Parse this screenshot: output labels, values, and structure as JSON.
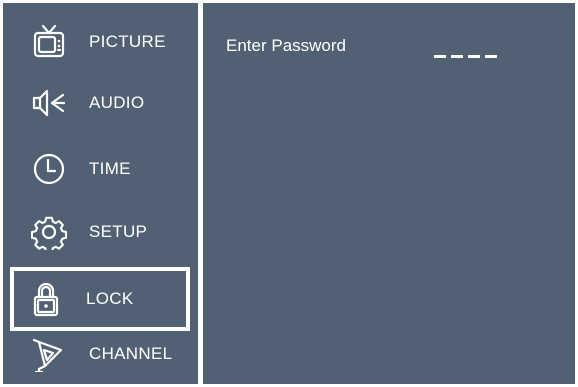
{
  "menu": {
    "items": [
      {
        "label": "PICTURE",
        "icon": "tv-icon",
        "selected": false
      },
      {
        "label": "AUDIO",
        "icon": "speaker-icon",
        "selected": false
      },
      {
        "label": "TIME",
        "icon": "clock-icon",
        "selected": false
      },
      {
        "label": "SETUP",
        "icon": "gear-icon",
        "selected": false
      },
      {
        "label": "LOCK",
        "icon": "lock-icon",
        "selected": true
      },
      {
        "label": "CHANNEL",
        "icon": "satellite-dish-icon",
        "selected": false
      }
    ]
  },
  "password": {
    "label": "Enter Password",
    "digits_entered": 0,
    "slots": 4
  },
  "colors": {
    "panel": "#516073",
    "text": "#ffffff",
    "frame": "#ffffff"
  }
}
